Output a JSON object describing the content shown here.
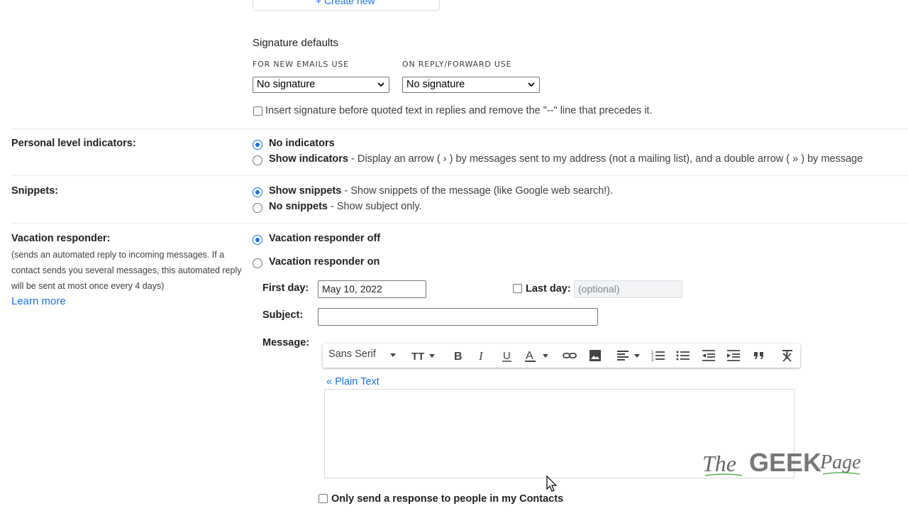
{
  "top": {
    "create_new_label": "+ Create new"
  },
  "signature_defaults": {
    "title": "Signature defaults",
    "new_emails_label": "FOR NEW EMAILS USE",
    "new_emails_value": "No signature",
    "reply_label": "ON REPLY/FORWARD USE",
    "reply_value": "No signature",
    "insert_before_quoted": "Insert signature before quoted text in replies and remove the \"--\" line that precedes it."
  },
  "personal_level": {
    "label": "Personal level indicators:",
    "option1": "No indicators",
    "option2": "Show indicators",
    "option2_desc": " - Display an arrow ( › ) by messages sent to my address (not a mailing list), and a double arrow ( » ) by message"
  },
  "snippets": {
    "label": "Snippets:",
    "option1": "Show snippets",
    "option1_desc": " - Show snippets of the message (like Google web search!).",
    "option2": "No snippets",
    "option2_desc": " - Show subject only."
  },
  "vacation": {
    "label": "Vacation responder:",
    "note": "(sends an automated reply to incoming messages. If a contact sends you several messages, this automated reply will be sent at most once every 4 days)",
    "learn_more": "Learn more",
    "off_label": "Vacation responder off",
    "on_label": "Vacation responder on",
    "first_day_label": "First day:",
    "first_day_value": "May 10, 2022",
    "last_day_label": "Last day:",
    "last_day_placeholder": "(optional)",
    "subject_label": "Subject:",
    "subject_value": "",
    "message_label": "Message:",
    "plain_text": "« Plain Text",
    "contacts_only": "Only send a response to people in my Contacts"
  },
  "toolbar": {
    "font": "Sans Serif",
    "icons": [
      "text-size-icon",
      "bold-icon",
      "italic-icon",
      "underline-icon",
      "text-color-icon",
      "link-icon",
      "image-icon",
      "align-icon",
      "numbered-list-icon",
      "bulleted-list-icon",
      "indent-less-icon",
      "indent-more-icon",
      "quote-icon",
      "remove-formatting-icon"
    ]
  },
  "watermark": {
    "text1": "The",
    "text2": "GEEK",
    "text3": "Page"
  },
  "colors": {
    "accent": "#1a73e8",
    "divider": "#e8eaed"
  }
}
